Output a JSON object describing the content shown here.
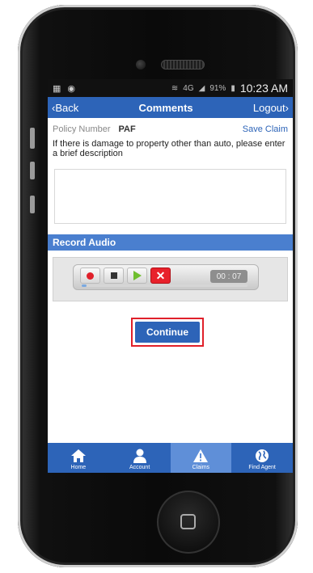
{
  "statusbar": {
    "left_icons": [
      "gallery-icon",
      "notification-icon"
    ],
    "network": "4G",
    "battery": "91%",
    "time": "10:23 AM"
  },
  "navbar": {
    "back": "Back",
    "title": "Comments",
    "logout": "Logout"
  },
  "form": {
    "policy_label": "Policy Number",
    "policy_value": "PAF",
    "save_claim": "Save Claim",
    "description": "If there is damage to property other than auto, please enter a brief description",
    "textarea_value": ""
  },
  "audio": {
    "header": "Record Audio",
    "timer": "00 : 07",
    "progress": 0.03,
    "controls": [
      "record-icon",
      "stop-icon",
      "play-icon",
      "delete-icon"
    ]
  },
  "continue_label": "Continue",
  "tabs": [
    {
      "label": "Home",
      "icon": "home-icon",
      "active": false
    },
    {
      "label": "Account",
      "icon": "account-icon",
      "active": false
    },
    {
      "label": "Claims",
      "icon": "warning-icon",
      "active": true
    },
    {
      "label": "Find Agent",
      "icon": "globe-icon",
      "active": false
    }
  ],
  "colors": {
    "primary": "#2d64b8",
    "section": "#4a7fcf",
    "highlight": "#e0202a",
    "active_tab": "#5f8fd8"
  }
}
